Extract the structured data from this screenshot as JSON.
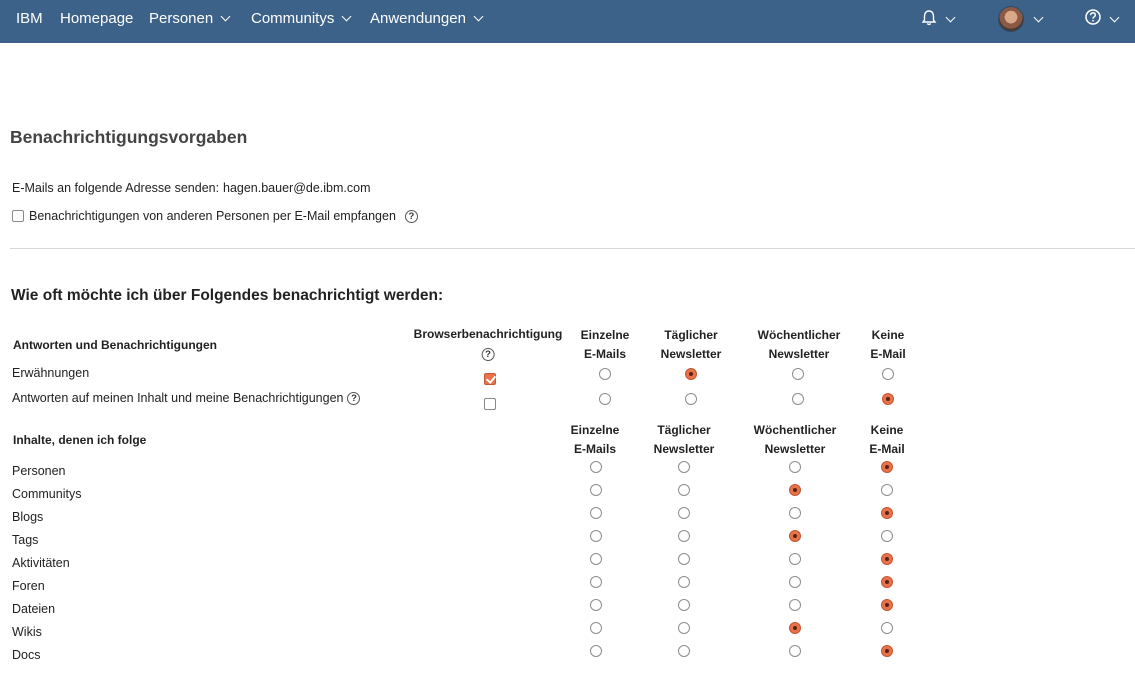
{
  "nav": {
    "brand": "IBM",
    "items": [
      {
        "label": "Homepage",
        "dropdown": false
      },
      {
        "label": "Personen",
        "dropdown": true
      },
      {
        "label": "Communitys",
        "dropdown": true
      },
      {
        "label": "Anwendungen",
        "dropdown": true
      }
    ],
    "right_icons": [
      "bell-icon",
      "avatar",
      "help-icon"
    ],
    "bar_color": "#3d6289"
  },
  "page": {
    "title": "Benachrichtigungsvorgaben",
    "email_label": "E-Mails an folgende Adresse senden:",
    "email_value": "hagen.bauer@de.ibm.com",
    "option_label": "Benachrichtigungen von anderen Personen per E-Mail empfangen",
    "option_checked": false,
    "question": "Wie oft möchte ich über Folgendes benachrichtigt werden:"
  },
  "group1": {
    "heading": "Antworten und Benachrichtigungen",
    "browser_column": "Browserbenachrichtigung",
    "columns": [
      [
        "Einzelne",
        "E-Mails"
      ],
      [
        "Täglicher",
        "Newsletter"
      ],
      [
        "Wöchentlicher",
        "Newsletter"
      ],
      [
        "Keine",
        "E-Mail"
      ]
    ],
    "rows": [
      {
        "label": "Erwähnungen",
        "help": false,
        "browser": true,
        "selected": 1
      },
      {
        "label": "Antworten auf meinen Inhalt und meine Benachrichtigungen",
        "help": true,
        "browser": false,
        "selected": 3
      }
    ]
  },
  "group2": {
    "heading": "Inhalte, denen ich folge",
    "columns": [
      [
        "Einzelne",
        "E-Mails"
      ],
      [
        "Täglicher",
        "Newsletter"
      ],
      [
        "Wöchentlicher",
        "Newsletter"
      ],
      [
        "Keine",
        "E-Mail"
      ]
    ],
    "rows": [
      {
        "label": "Personen",
        "selected": 3
      },
      {
        "label": "Communitys",
        "selected": 2
      },
      {
        "label": "Blogs",
        "selected": 3
      },
      {
        "label": "Tags",
        "selected": 2
      },
      {
        "label": "Aktivitäten",
        "selected": 3
      },
      {
        "label": "Foren",
        "selected": 3
      },
      {
        "label": "Dateien",
        "selected": 3
      },
      {
        "label": "Wikis",
        "selected": 2
      },
      {
        "label": "Docs",
        "selected": 3
      }
    ]
  },
  "accent_color": "#e8734a"
}
